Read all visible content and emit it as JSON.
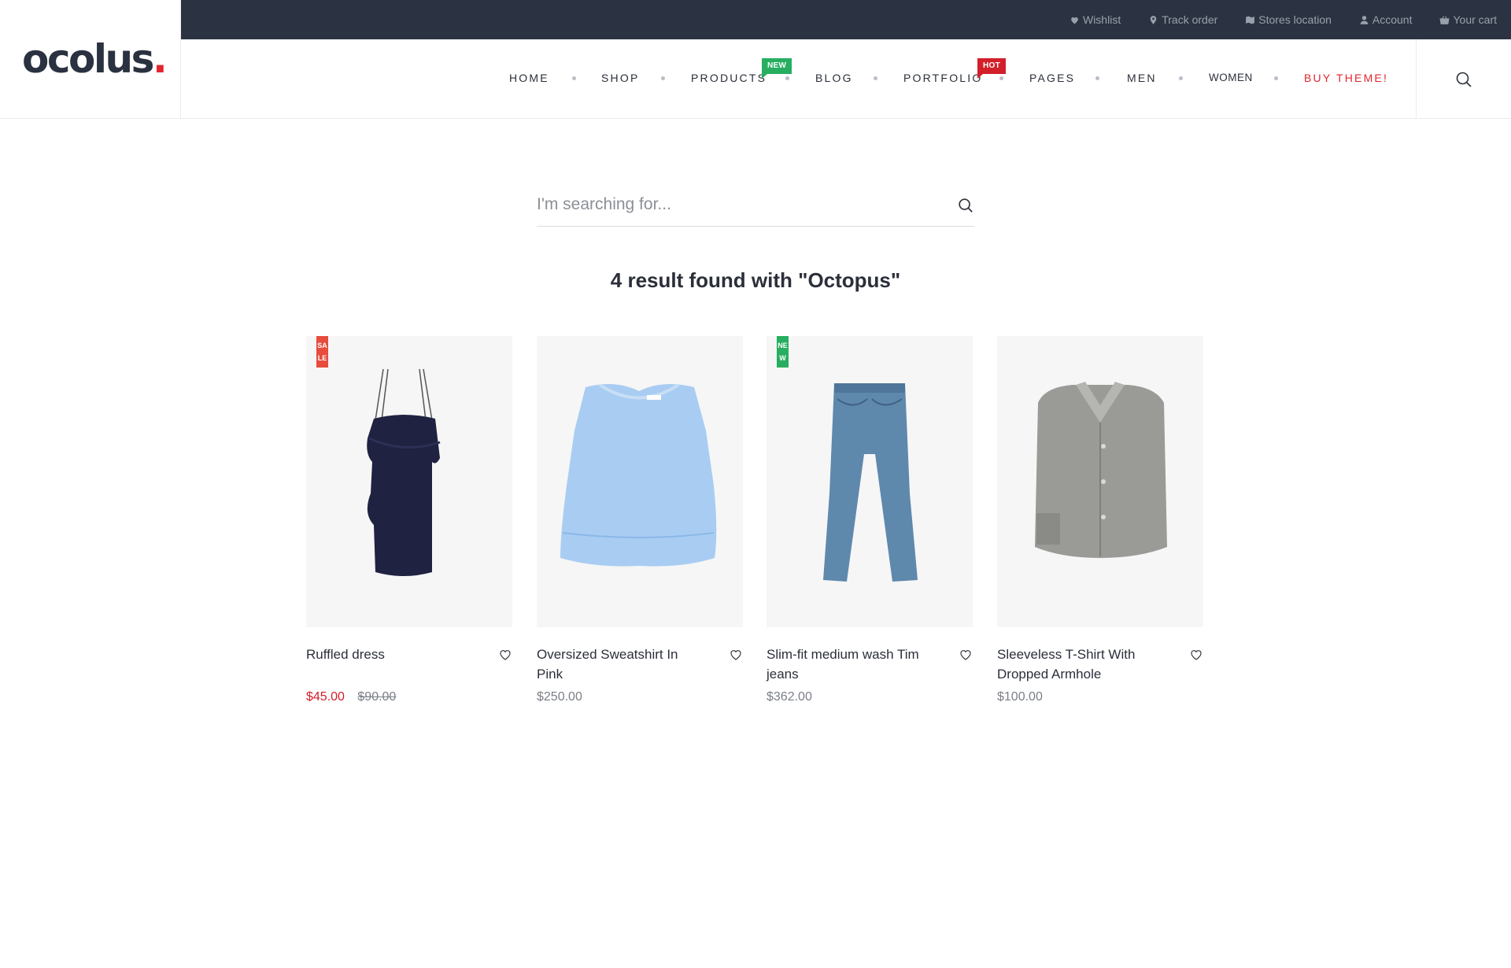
{
  "brand": {
    "logo_text": "ocolus",
    "logo_dot": "."
  },
  "topbar": {
    "links": [
      {
        "label": "Wishlist",
        "icon": "heart-icon"
      },
      {
        "label": "Track order",
        "icon": "map-pin-icon"
      },
      {
        "label": "Stores location",
        "icon": "map-icon"
      },
      {
        "label": "Account",
        "icon": "user-icon"
      },
      {
        "label": "Your cart",
        "icon": "basket-icon"
      }
    ]
  },
  "nav": {
    "items": [
      {
        "label": "HOME"
      },
      {
        "label": "SHOP"
      },
      {
        "label": "PRODUCTS",
        "badge": "NEW"
      },
      {
        "label": "BLOG"
      },
      {
        "label": "PORTFOLIO",
        "badge": "HOT"
      },
      {
        "label": "PAGES"
      },
      {
        "label": "MEN"
      },
      {
        "label": "WOMEN"
      },
      {
        "label": "BUY THEME!"
      }
    ]
  },
  "colors": {
    "topbar_bg": "#2b3342",
    "accent_red": "#e3262f",
    "badge_new": "#27ae60",
    "badge_hot": "#d21f2a",
    "sale_price": "#d21f2a"
  },
  "search": {
    "placeholder": "I'm searching for...",
    "value": ""
  },
  "results": {
    "title": "4 result found with \"Octopus\""
  },
  "products": [
    {
      "name": "Ruffled dress",
      "ribbon": "SALE",
      "price": "$45.00",
      "old_price": "$90.00",
      "icon": "dress-image"
    },
    {
      "name": "Oversized Sweatshirt In Pink",
      "price": "$250.00",
      "icon": "top-image"
    },
    {
      "name": "Slim-fit medium wash Tim jeans",
      "ribbon": "NEW",
      "price": "$362.00",
      "icon": "jeans-image"
    },
    {
      "name": "Sleeveless T-Shirt With Dropped Armhole",
      "price": "$100.00",
      "icon": "shirt-image"
    }
  ]
}
